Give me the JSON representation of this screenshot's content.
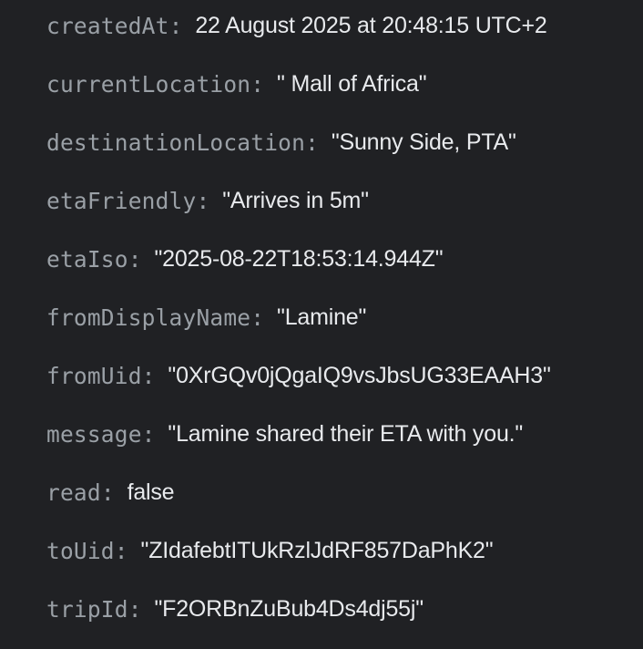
{
  "fields": [
    {
      "key": "createdAt",
      "value": "22 August 2025 at 20:48:15 UTC+2"
    },
    {
      "key": "currentLocation",
      "value": "\" Mall of Africa\""
    },
    {
      "key": "destinationLocation",
      "value": "\"Sunny Side, PTA\""
    },
    {
      "key": "etaFriendly",
      "value": "\"Arrives in 5m\""
    },
    {
      "key": "etaIso",
      "value": "\"2025-08-22T18:53:14.944Z\""
    },
    {
      "key": "fromDisplayName",
      "value": "\"Lamine\""
    },
    {
      "key": "fromUid",
      "value": "\"0XrGQv0jQgaIQ9vsJbsUG33EAAH3\""
    },
    {
      "key": "message",
      "value": "\"Lamine shared their ETA with you.\""
    },
    {
      "key": "read",
      "value": "false"
    },
    {
      "key": "toUid",
      "value": "\"ZIdafebtITUkRzlJdRF857DaPhK2\""
    },
    {
      "key": "tripId",
      "value": "\"F2ORBnZuBub4Ds4dj55j\""
    }
  ],
  "colors": {
    "background": "#202124",
    "key": "#9aa0a6",
    "value": "#e8eaed"
  }
}
